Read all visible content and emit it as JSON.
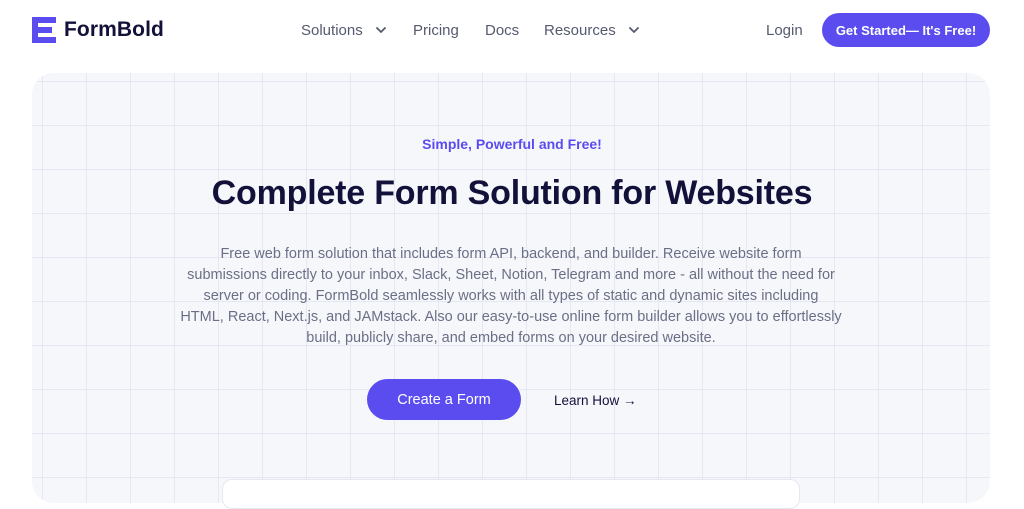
{
  "brand": {
    "name": "FormBold",
    "logo_icon": "formbold-logo-icon",
    "accent": "#5b4cf0"
  },
  "nav": {
    "items": [
      {
        "label": "Solutions",
        "has_dropdown": true
      },
      {
        "label": "Pricing",
        "has_dropdown": false
      },
      {
        "label": "Docs",
        "has_dropdown": false
      },
      {
        "label": "Resources",
        "has_dropdown": true
      }
    ],
    "login_label": "Login",
    "cta_label": "Get Started— It's Free!"
  },
  "hero": {
    "tagline": "Simple, Powerful and Free!",
    "headline": "Complete Form Solution for Websites",
    "description": "Free web form solution that includes form API, backend, and builder. Receive website form submissions directly to your inbox, Slack, Sheet, Notion, Telegram and more - all without the need for server or coding. FormBold seamlessly works with all types of static and dynamic sites including HTML, React, Next.js, and JAMstack. Also our easy-to-use online form builder allows you to effortlessly build, publicly share, and embed forms on your desired website.",
    "primary_button": "Create a Form",
    "secondary_button": "Learn How →"
  }
}
